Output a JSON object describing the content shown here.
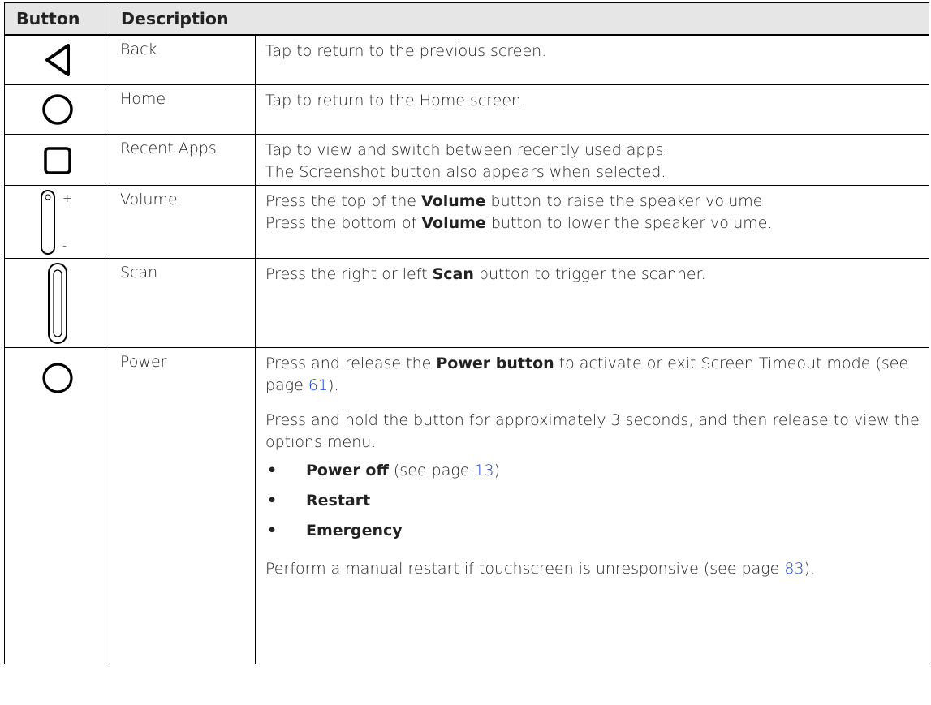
{
  "table": {
    "headers": {
      "button": "Button",
      "description": "Description"
    },
    "rows": [
      {
        "icon": "back-triangle-icon",
        "name": "Back",
        "desc": [
          "Tap to return to the previous screen."
        ]
      },
      {
        "icon": "home-circle-icon",
        "name": "Home",
        "desc": [
          "Tap to return to the Home screen."
        ]
      },
      {
        "icon": "recent-apps-square-icon",
        "name": "Recent Apps",
        "desc": [
          "Tap to view and switch between recently used apps.",
          "The Screenshot button also appears when selected."
        ]
      },
      {
        "icon": "volume-rocker-icon",
        "name": "Volume",
        "desc1_pre": "Press the top of the ",
        "desc1_bold": "Volume",
        "desc1_post": " button to raise the speaker volume.",
        "desc2_pre": "Press the bottom of ",
        "desc2_bold": "Volume",
        "desc2_post": " button to lower the speaker volume.",
        "plus": "+",
        "minus": "-"
      },
      {
        "icon": "scan-button-icon",
        "name": "Scan",
        "desc_pre": "Press the right or left ",
        "desc_bold": "Scan",
        "desc_post": " button to trigger the scanner."
      },
      {
        "icon": "power-circle-icon",
        "name": "Power",
        "p1_pre": "Press and release the ",
        "p1_bold": "Power button",
        "p1_mid": " to activate or exit Screen Timeout mode (see page ",
        "p1_link": "61",
        "p1_post": ").",
        "p2": "Press and hold the button for approximately 3 seconds, and then release to view the options menu.",
        "bullets": {
          "b1_bold": "Power off",
          "b1_pre": " (see page ",
          "b1_link": "13",
          "b1_post": ")",
          "b2": "Restart",
          "b3": "Emergency",
          "dot": "•"
        },
        "p3_pre": "Perform a manual restart if touchscreen is unresponsive (see page ",
        "p3_link": "83",
        "p3_post": ")."
      }
    ]
  },
  "colors": {
    "link": "#1a3fd6",
    "header_bg": "#e6e6e6"
  }
}
